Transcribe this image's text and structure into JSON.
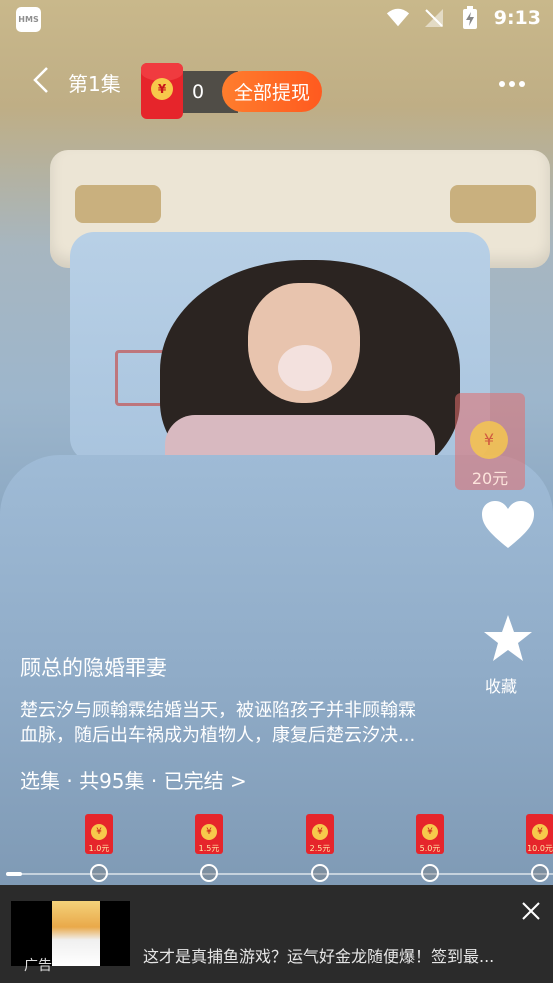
{
  "status_bar": {
    "launcher_label": "HMS",
    "time": "9:13"
  },
  "player": {
    "episode_title": "第1集",
    "coin_count": "0",
    "withdraw_label": "全部提现",
    "envelope_symbol": "¥"
  },
  "side_panel": {
    "reward_amount": "20元",
    "favorite_label": "收藏"
  },
  "drama": {
    "title": "顾总的隐婚罪妻",
    "synopsis_line1": "楚云汐与顾翰霖结婚当天，被诬陷孩子并非顾翰霖",
    "synopsis_line2": "血脉，随后出车祸成为植物人，康复后楚云汐决...",
    "episode_selector": "选集 · 共95集 · 已完结 >"
  },
  "reward_track": {
    "progress": 0.02,
    "milestones": [
      {
        "amount": "1.0元"
      },
      {
        "amount": "1.5元"
      },
      {
        "amount": "2.5元"
      },
      {
        "amount": "5.0元"
      },
      {
        "amount": "10.0元"
      }
    ]
  },
  "ad": {
    "badge": "广告",
    "text": "这才是真捕鱼游戏？运气好金龙随便爆！签到最..."
  },
  "colors": {
    "envelope_red": "#e6252b",
    "withdraw_orange": "#ff6a25",
    "ad_background": "#2b2b2b"
  }
}
